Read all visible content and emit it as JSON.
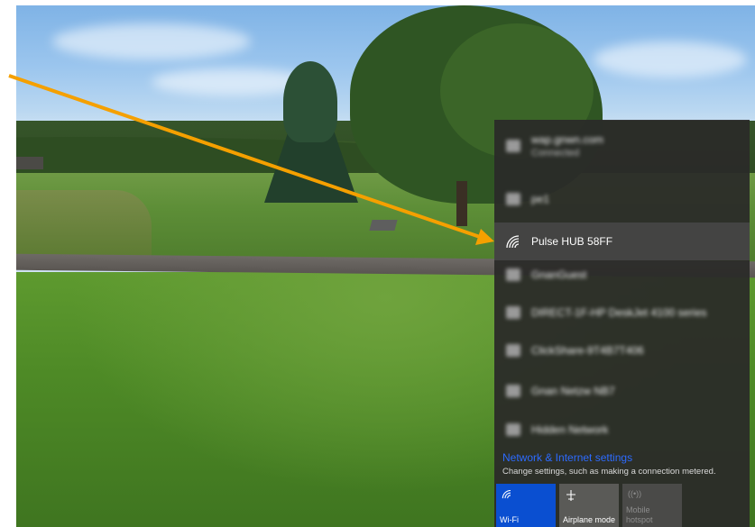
{
  "networks": {
    "connected": {
      "name": "wap.gnwn.com",
      "status": "Connected",
      "icon": "ethernet-icon"
    },
    "items": [
      {
        "name": "pe1",
        "icon": "secured-network-icon",
        "selected": false
      },
      {
        "name": "Pulse HUB 58FF",
        "icon": "wifi-icon",
        "selected": true
      },
      {
        "name": "GnanGuest",
        "icon": "wifi-icon",
        "selected": false
      },
      {
        "name": "DIRECT-1F-HP DeskJet 4100 series",
        "icon": "secured-network-icon",
        "selected": false
      },
      {
        "name": "ClickShare-9T4B7T406",
        "icon": "secured-network-icon",
        "selected": false
      },
      {
        "name": "Gnan Netzw NB7",
        "icon": "secured-network-icon",
        "selected": false
      },
      {
        "name": "Hidden Network",
        "icon": "secured-network-icon",
        "selected": false
      }
    ]
  },
  "settings": {
    "title": "Network & Internet settings",
    "subtitle": "Change settings, such as making a connection metered."
  },
  "quick_actions": {
    "wifi": {
      "label": "Wi-Fi",
      "icon": "wifi-icon",
      "color": "#0a4fd1",
      "active": true
    },
    "airplane": {
      "label": "Airplane mode",
      "icon": "airplane-icon",
      "active": false
    },
    "hotspot": {
      "label": "Mobile\nhotspot",
      "label_line1": "Mobile",
      "label_line2": "hotspot",
      "icon": "hotspot-icon",
      "active": false
    }
  },
  "annotation": {
    "arrow_color": "#f5a000"
  }
}
